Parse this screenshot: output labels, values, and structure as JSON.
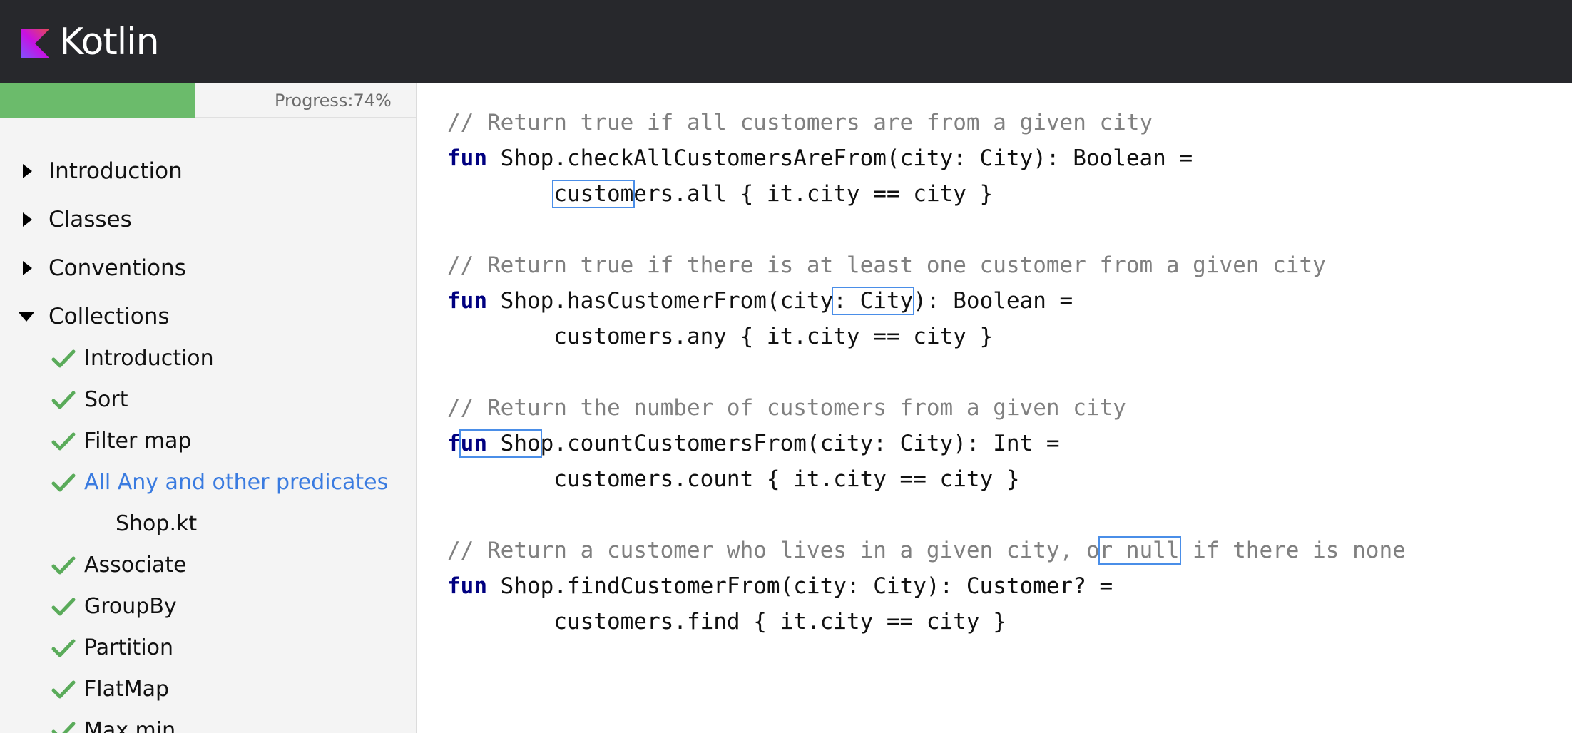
{
  "app": {
    "brand_name": "Kotlin",
    "colors": {
      "header_bg": "#27282c",
      "progress_fill": "#6bbb6b",
      "active_link": "#3a7be0",
      "check": "#5aab5a",
      "keyword": "#000080",
      "comment": "#808080",
      "highlight_border": "#4a8ee8"
    }
  },
  "progress": {
    "label": "Progress:",
    "value_text": "74%",
    "fraction": 0.47
  },
  "sidebar": {
    "sections": [
      {
        "label": "Introduction",
        "expanded": false,
        "icon": "triangle-right-icon"
      },
      {
        "label": "Classes",
        "expanded": false,
        "icon": "triangle-right-icon"
      },
      {
        "label": "Conventions",
        "expanded": false,
        "icon": "triangle-right-icon"
      },
      {
        "label": "Collections",
        "expanded": true,
        "icon": "triangle-down-icon"
      }
    ],
    "collections_items": [
      {
        "label": "Introduction",
        "completed": true
      },
      {
        "label": "Sort",
        "completed": true
      },
      {
        "label": "Filter map",
        "completed": true
      },
      {
        "label": "All Any and other predicates",
        "completed": true,
        "active": true
      },
      {
        "label": "Shop.kt",
        "is_file": true
      },
      {
        "label": "Associate",
        "completed": true
      },
      {
        "label": "GroupBy",
        "completed": true
      },
      {
        "label": "Partition",
        "completed": true
      },
      {
        "label": "FlatMap",
        "completed": true
      },
      {
        "label": "Max min",
        "completed": true
      }
    ]
  },
  "code": {
    "blocks": [
      {
        "comment": "// Return true if all customers are from a given city",
        "kw": "fun",
        "signature": " Shop.checkAllCustomersAreFrom(city: City): Boolean =",
        "body_pre": "        ",
        "body_hl": "custom",
        "body_post": "ers.all { it.city == city }"
      },
      {
        "comment": "// Return true if there is at least one customer from a given city",
        "kw": "fun",
        "sig_pre": " Shop.hasCustomerFrom(city",
        "sig_hl": ": City",
        "sig_post": "): Boolean =",
        "body": "        customers.any { it.city == city }"
      },
      {
        "comment": "// Return the number of customers from a given city",
        "kw_pre": "f",
        "kw_hl": "un",
        "hl_rest": " Sho",
        "sig_post": "p.countCustomersFrom(city: City): Int =",
        "body": "        customers.count { it.city == city }"
      },
      {
        "comment_pre": "// Return a customer who lives in a given city, o",
        "comment_hl": "r null",
        "comment_post": " if there is none",
        "kw": "fun",
        "signature": " Shop.findCustomerFrom(city: City): Customer? =",
        "body": "        customers.find { it.city == city }"
      }
    ]
  }
}
